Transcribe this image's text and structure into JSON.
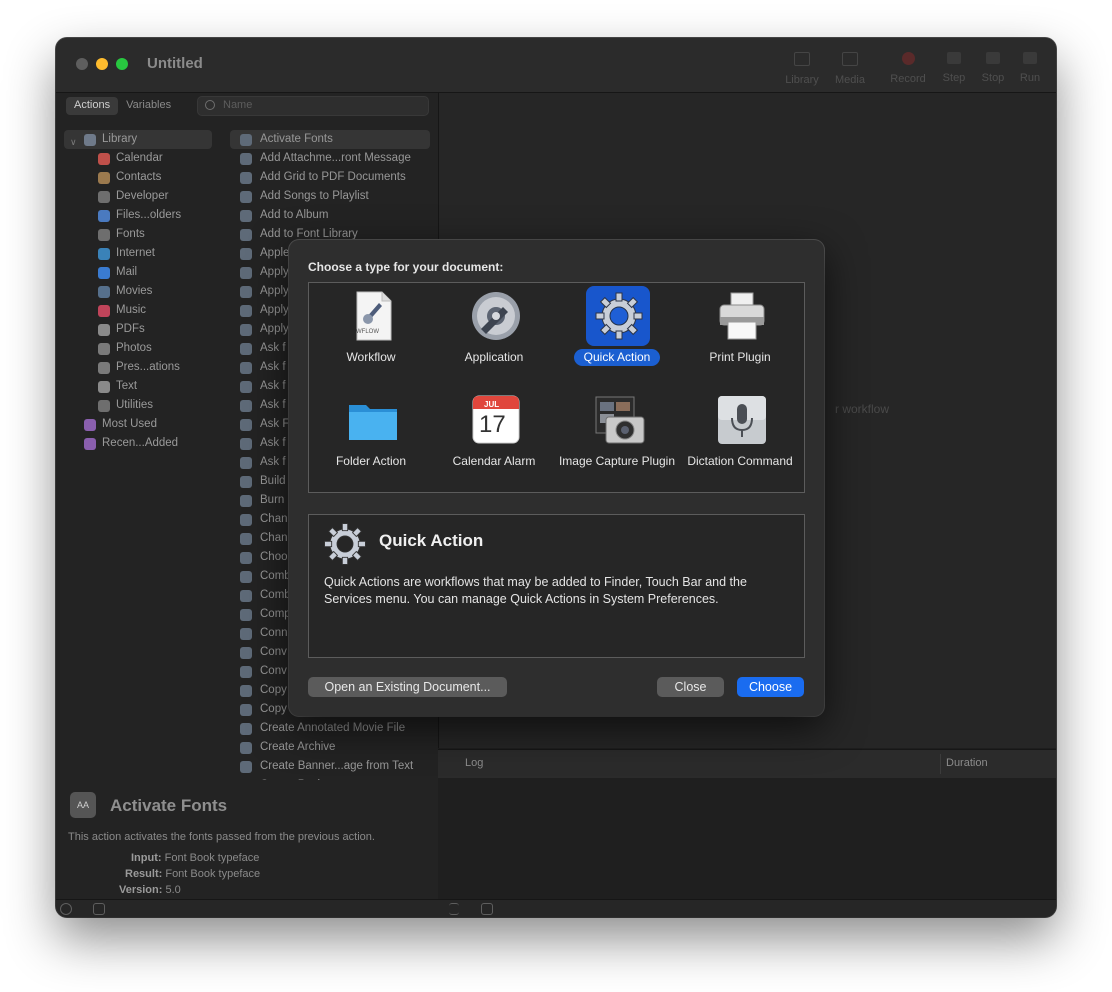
{
  "window": {
    "title": "Untitled"
  },
  "toolbar": [
    {
      "name": "library",
      "label": "Library"
    },
    {
      "name": "media",
      "label": "Media"
    },
    {
      "name": "record",
      "label": "Record"
    },
    {
      "name": "step",
      "label": "Step"
    },
    {
      "name": "stop",
      "label": "Stop"
    },
    {
      "name": "run",
      "label": "Run"
    }
  ],
  "sidebar": {
    "tabs": [
      "Actions",
      "Variables"
    ],
    "search_placeholder": "Name",
    "library": [
      {
        "label": "Library",
        "color": "#6f7a8a"
      },
      {
        "label": "Calendar",
        "color": "#c0504a"
      },
      {
        "label": "Contacts",
        "color": "#9c7a4e"
      },
      {
        "label": "Developer",
        "color": "#6e6e6e"
      },
      {
        "label": "Files...olders",
        "color": "#4a7ac0"
      },
      {
        "label": "Fonts",
        "color": "#6e6e6e"
      },
      {
        "label": "Internet",
        "color": "#3a82b8"
      },
      {
        "label": "Mail",
        "color": "#3a7bd0"
      },
      {
        "label": "Movies",
        "color": "#56708c"
      },
      {
        "label": "Music",
        "color": "#c0445a"
      },
      {
        "label": "PDFs",
        "color": "#8a8a8a"
      },
      {
        "label": "Photos",
        "color": "#7a7a7a"
      },
      {
        "label": "Pres...ations",
        "color": "#7a7a7a"
      },
      {
        "label": "Text",
        "color": "#8a8a8a"
      },
      {
        "label": "Utilities",
        "color": "#6e6e6e"
      },
      {
        "label": "Most Used",
        "color": "#8a5fae"
      },
      {
        "label": "Recen...Added",
        "color": "#8a5fae"
      }
    ],
    "actions": [
      "Activate Fonts",
      "Add Attachme...ront Message",
      "Add Grid to PDF Documents",
      "Add Songs to Playlist",
      "Add to Album",
      "Add to Font Library",
      "Apple",
      "Apply",
      "Apply",
      "Apply",
      "Apply",
      "Ask f",
      "Ask f",
      "Ask f",
      "Ask f",
      "Ask F",
      "Ask f",
      "Ask f",
      "Build",
      "Burn",
      "Chan",
      "Chan",
      "Choo",
      "Comb",
      "Comb",
      "Comp",
      "Conn",
      "Conv",
      "Conv",
      "Copy",
      "Copy",
      "Create Annotated Movie File",
      "Create Archive",
      "Create Banner...age from Text",
      "Create Package"
    ]
  },
  "description": {
    "icon_text": "AA",
    "title": "Activate Fonts",
    "text": "This action activates the fonts passed from the previous action.",
    "input_label": "Input:",
    "input_value": "Font Book typeface",
    "result_label": "Result:",
    "result_value": "Font Book typeface",
    "version_label": "Version:",
    "version_value": "5.0"
  },
  "workflow_area": {
    "hint": "r workflow"
  },
  "log": {
    "log_label": "Log",
    "duration_label": "Duration"
  },
  "dialog": {
    "heading": "Choose a type for your document:",
    "types": [
      {
        "label": "Workflow",
        "icon": "workflow-icon",
        "selected": false
      },
      {
        "label": "Application",
        "icon": "application-icon",
        "selected": false
      },
      {
        "label": "Quick Action",
        "icon": "quick-action-gear-icon",
        "selected": true
      },
      {
        "label": "Print Plugin",
        "icon": "printer-icon",
        "selected": false
      },
      {
        "label": "Folder Action",
        "icon": "folder-icon",
        "selected": false
      },
      {
        "label": "Calendar Alarm",
        "icon": "calendar-icon",
        "selected": false
      },
      {
        "label": "Image Capture Plugin",
        "icon": "camera-icon",
        "selected": false
      },
      {
        "label": "Dictation Command",
        "icon": "microphone-icon",
        "selected": false
      }
    ],
    "workflow_badge": "WFLOW",
    "calendar_month": "JUL",
    "calendar_day": "17",
    "info_title": "Quick Action",
    "info_text": "Quick Actions are workflows that may be added to Finder, Touch Bar and the Services menu. You can manage Quick Actions in System Preferences.",
    "open_existing_label": "Open an Existing Document...",
    "close_label": "Close",
    "choose_label": "Choose"
  },
  "colors": {
    "accent": "#1a6cf0",
    "selection": "#1b5fd1"
  }
}
